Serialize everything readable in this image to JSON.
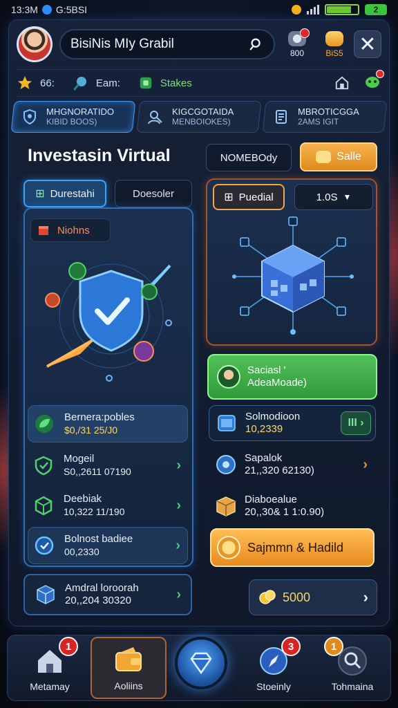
{
  "statusbar": {
    "time": "13:3M",
    "carrier": "G:5BSI",
    "battery_num": "2",
    "battery_level": 0.8
  },
  "header": {
    "search_text": "BisiNis MIy Grabil",
    "stat1_value": "800",
    "stat2_value": "BiS5",
    "close_label": "✕"
  },
  "quickrow": {
    "item1_value": "66:",
    "item2_label": "Eam:",
    "item3_label": "Stakes"
  },
  "toptabs": [
    {
      "label": "MHGNORATIDO",
      "sub": "KIBID BOOS)"
    },
    {
      "label": "KIGCGOTAIDA",
      "sub": "MENBOIOKES)"
    },
    {
      "label": "MBROTICGGA",
      "sub": "2AMS IGIT"
    }
  ],
  "left": {
    "title": "Investasin Virtual",
    "subtab_active": "Durestahi",
    "subtab_idle": "Doesoler",
    "notions_label": "Niohns",
    "rows": [
      {
        "title": "Bernera:pobles",
        "value": "$0,/31 25/J0"
      },
      {
        "title": "Mogeil",
        "value": "S0,,2611 07190"
      },
      {
        "title": "Deebiak",
        "value": "10,322 11/190"
      },
      {
        "title": "Bolnost badiee",
        "value": "00,2330"
      }
    ],
    "bottom_card": {
      "title": "Amdral loroorah",
      "value": "20,,204 30320"
    }
  },
  "right": {
    "nomeb_label": "NOMEBOdy",
    "saile_label": "Salle",
    "puedial_label": "Puedial",
    "rate_value": "1.0S",
    "green_card": {
      "title": "Saciasl '",
      "value": "AdeaMoade)"
    },
    "rows": [
      {
        "title": "Solmodioon",
        "value": "10,2339",
        "pill": "III"
      },
      {
        "title": "Sapalok",
        "value": "21,,320 62130)"
      },
      {
        "title": "Diaboealue",
        "value": "20,,30& 1 1:0.90)"
      }
    ],
    "orange_btn_label": "Sajmmn & Hadild",
    "coin_value": "5000"
  },
  "bottomnav": [
    {
      "label": "Metamay",
      "badge": "1"
    },
    {
      "label": "Aoliins",
      "badge": ""
    },
    {
      "label": "Stoeinly",
      "badge": "3"
    },
    {
      "label": "Tohmaina",
      "badge": "1"
    }
  ],
  "colors": {
    "accent_blue": "#3e9cff",
    "accent_orange": "#e98a1f",
    "accent_green": "#52c05a",
    "badge_red": "#d92424"
  }
}
